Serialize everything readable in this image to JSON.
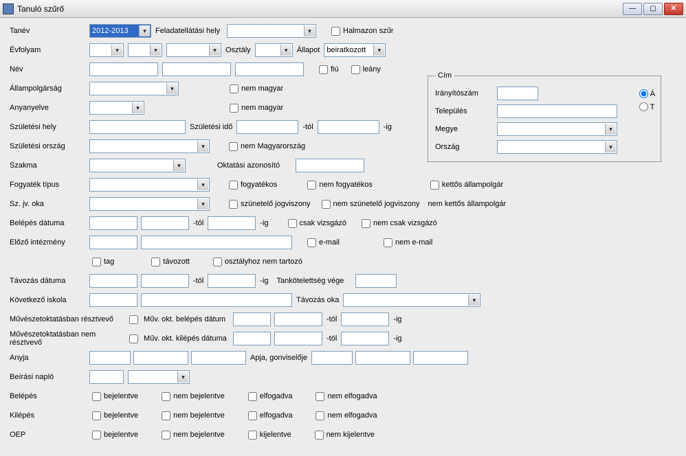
{
  "window": {
    "title": "Tanuló szűrő"
  },
  "labels": {
    "tanev": "Tanév",
    "feladat": "Feladatellátási hely",
    "halmazon": "Halmazon szűr",
    "evfolyam": "Évfolyam",
    "osztaly": "Osztály",
    "allapot": "Állapot",
    "nev": "Név",
    "allampolg": "Állampolgárság",
    "anyanyelv": "Anyanyelve",
    "szulhely": "Születési hely",
    "szulido": "Születési idő",
    "szulorszag": "Születési ország",
    "szakma": "Szakma",
    "oktazon": "Oktatási azonosító",
    "fogytipus": "Fogyaték típus",
    "szjvoka": "Sz. jv. oka",
    "belepes_dat": "Belépés dátuma",
    "elozo_int": "Előző intézmény",
    "tavozas_dat": "Távozás dátuma",
    "kov_iskola": "Következő iskola",
    "tavozas_oka": "Távozás oka",
    "muv_reszt": "Művészetoktatásban résztvevő",
    "muv_nemreszt": "Művészetoktatásban nem résztvevő",
    "muv_belep": "Műv. okt. belépés dátum",
    "muv_kilep": "Műv. okt. kilépés dátuma",
    "anyja": "Anyja",
    "apja": "Apja, gonviselője",
    "beirasi": "Beírási napló",
    "belepes": "Belépés",
    "kilepes": "Kilépés",
    "oep": "OEP",
    "tankot_vege": "Tankötelettség vége",
    "fiu": "fiú",
    "leany": "leány",
    "nem_magyar": "nem magyar",
    "nem_mo": "nem Magyarország",
    "fogyatekos": "fogyatékos",
    "nem_fogyatekos": "nem fogyatékos",
    "kettos": "kettős állampolgár",
    "szunetelo": "szünetelő jogviszony",
    "nem_szunetelo": "nem szünetelő jogviszony",
    "nem_kettos": "nem kettős állampolgár",
    "tol": "-tól",
    "ig": "-ig",
    "csak_vizsg": "csak vizsgázó",
    "nem_csak_vizsg": "nem csak vizsgázó",
    "email": "e-mail",
    "nem_email": "nem e-mail",
    "tag": "tag",
    "tavozott": "távozott",
    "osztalyhoz": "osztályhoz nem tartozó",
    "bejelentve": "bejelentve",
    "nem_bejelentve": "nem bejelentve",
    "elfogadva": "elfogadva",
    "nem_elfogadva": "nem elfogadva",
    "kijelentve": "kijelentve",
    "nem_kijelentve": "nem kijelentve"
  },
  "address": {
    "legend": "Cím",
    "iranyitoszam": "Irányítószám",
    "telepules": "Település",
    "megye": "Megye",
    "orszag": "Ország",
    "radio_a": "Á",
    "radio_t": "T"
  },
  "values": {
    "tanev": "2012-2013",
    "allapot": "beiratkozott"
  }
}
